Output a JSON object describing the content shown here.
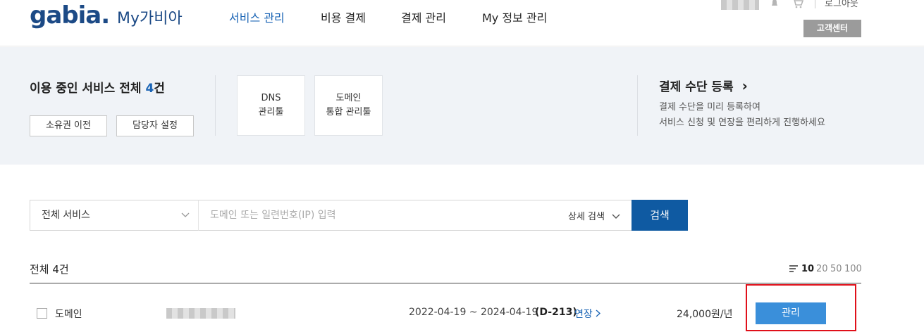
{
  "header": {
    "logo": "gabia.",
    "logo_sub": "My가비아",
    "nav": [
      {
        "label": "서비스 관리",
        "active": true
      },
      {
        "label": "비용 결제",
        "active": false
      },
      {
        "label": "결제 관리",
        "active": false
      },
      {
        "label": "My 정보 관리",
        "active": false
      }
    ],
    "logout": "로그아웃",
    "customer_center": "고객센터"
  },
  "summary": {
    "title_prefix": "이용 중인 서비스 전체 ",
    "count": "4",
    "title_suffix": "건",
    "transfer_button": "소유권 이전",
    "manager_button": "담당자 설정",
    "tiles": [
      {
        "line1": "DNS",
        "line2": "관리툴"
      },
      {
        "line1": "도메인",
        "line2": "통합 관리툴"
      }
    ],
    "payment_title": "결제 수단 등록",
    "payment_arrow": "›",
    "payment_desc1": "결제 수단을 미리 등록하여",
    "payment_desc2": "서비스 신청 및 연장을 편리하게 진행하세요"
  },
  "search": {
    "service_select": "전체 서비스",
    "placeholder": "도메인 또는 일련번호(IP) 입력",
    "advanced_label": "상세 검색",
    "button": "검색"
  },
  "list": {
    "total": "전체 4건",
    "page_sizes": [
      "10",
      "20",
      "50",
      "100"
    ],
    "selected_page_size": "10",
    "rows": [
      {
        "type": "도메인",
        "period": "2022-04-19 ~ 2024-04-19",
        "dday": "(D-213)",
        "renew": "연장",
        "price": "24,000원/년",
        "manage": "관리"
      }
    ]
  },
  "colors": {
    "brand": "#1c4a86",
    "accent": "#1a64b5",
    "search_button": "#0f5aa2",
    "manage_button": "#3a8fda",
    "highlight": "#e0101a"
  }
}
